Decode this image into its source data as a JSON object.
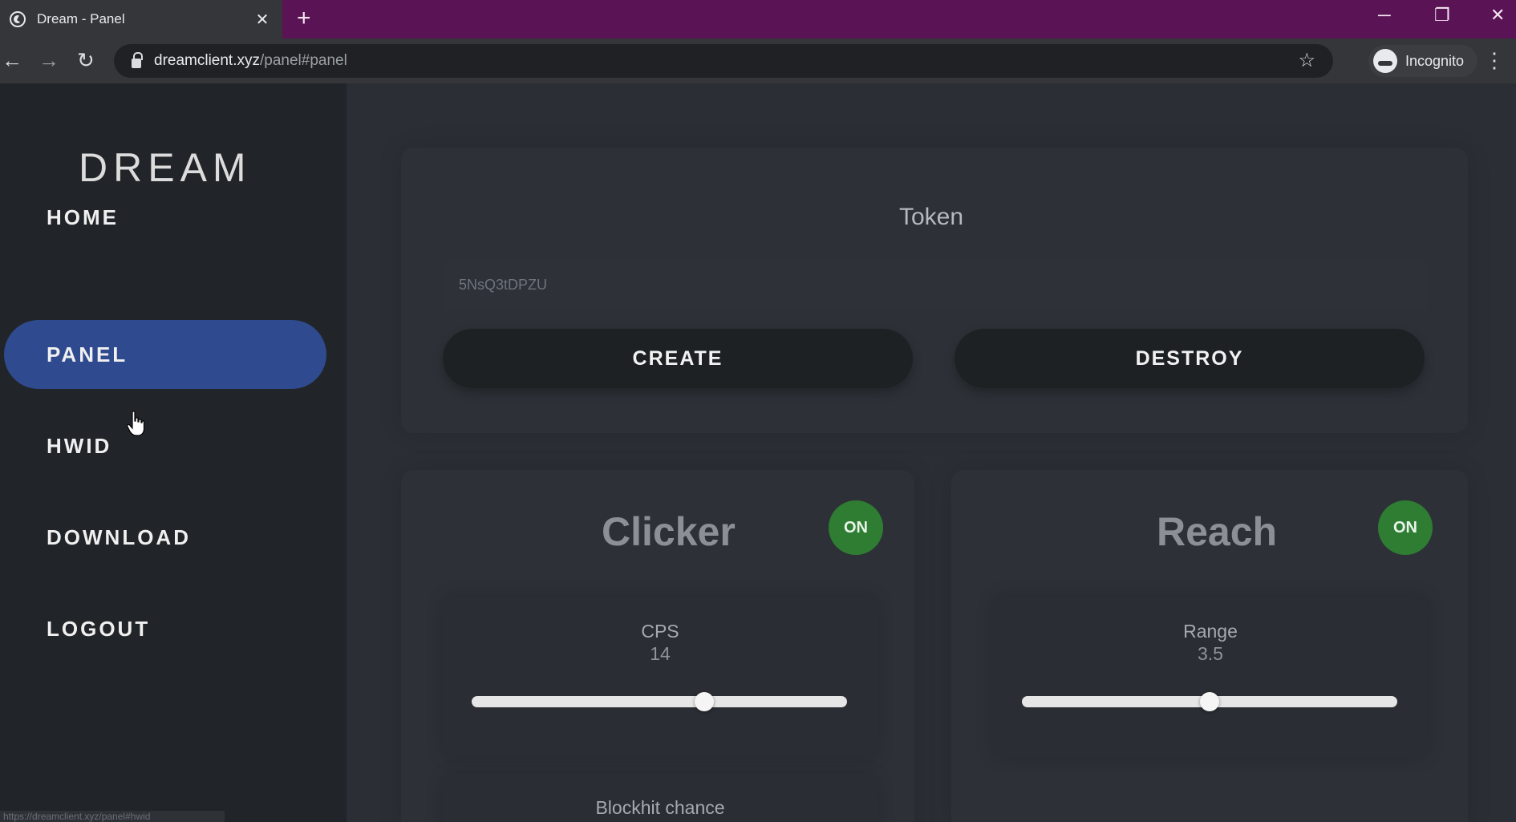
{
  "browser": {
    "tab_title": "Dream - Panel",
    "url_host": "dreamclient.xyz",
    "url_path": "/panel#panel",
    "incognito_label": "Incognito"
  },
  "sidebar": {
    "logo": "DREAM",
    "items": [
      {
        "label": "HOME",
        "active": false
      },
      {
        "label": "PANEL",
        "active": true
      },
      {
        "label": "HWID",
        "active": false
      },
      {
        "label": "DOWNLOAD",
        "active": false
      },
      {
        "label": "LOGOUT",
        "active": false
      }
    ],
    "status_url": "https://dreamclient.xyz/panel#hwid"
  },
  "token": {
    "title": "Token",
    "value": "5NsQ3tDPZU",
    "create_label": "CREATE",
    "destroy_label": "DESTROY"
  },
  "modules": {
    "clicker": {
      "title": "Clicker",
      "status": "ON",
      "cps_label": "CPS",
      "cps_value": "14",
      "cps_fraction": 0.62,
      "next_label": "Blockhit chance"
    },
    "reach": {
      "title": "Reach",
      "status": "ON",
      "range_label": "Range",
      "range_value": "3.5",
      "range_fraction": 0.5
    }
  },
  "colors": {
    "accent_active": "#2f4a8e",
    "badge_on": "#2e7d32",
    "tabbar": "#5a1355"
  }
}
